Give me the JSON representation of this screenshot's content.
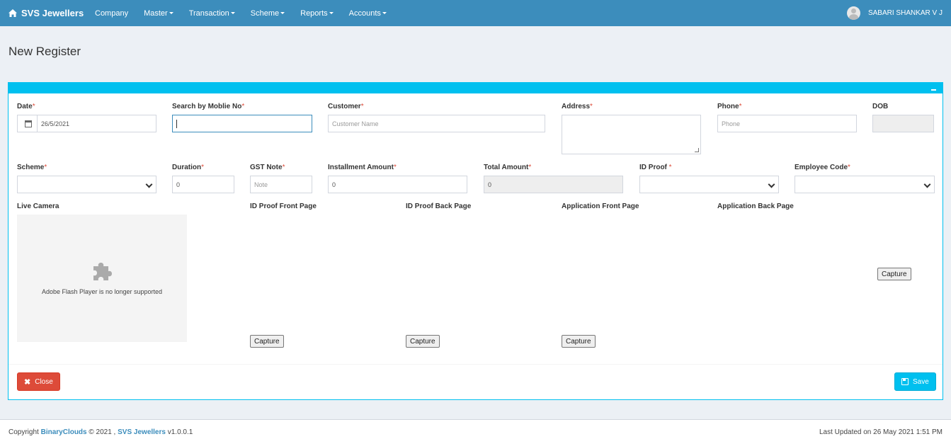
{
  "navbar": {
    "brand": "SVS Jewellers",
    "menu": [
      "Company",
      "Master",
      "Transaction",
      "Scheme",
      "Reports",
      "Accounts"
    ],
    "user": "SABARI SHANKAR V J"
  },
  "page": {
    "title": "New Register"
  },
  "form": {
    "date": {
      "label": "Date",
      "value": "26/5/2021"
    },
    "mobile": {
      "label": "Search by Moblie No",
      "value": ""
    },
    "customer": {
      "label": "Customer",
      "placeholder": "Customer Name"
    },
    "address": {
      "label": "Address",
      "value": ""
    },
    "phone": {
      "label": "Phone",
      "placeholder": "Phone"
    },
    "dob": {
      "label": "DOB",
      "value": ""
    },
    "scheme": {
      "label": "Scheme",
      "value": ""
    },
    "duration": {
      "label": "Duration",
      "value": "0"
    },
    "gst_note": {
      "label": "GST Note",
      "placeholder": "Note"
    },
    "installment": {
      "label": "Installment Amount",
      "value": "0"
    },
    "total": {
      "label": "Total Amount",
      "value": "0"
    },
    "id_proof": {
      "label": "ID Proof ",
      "value": ""
    },
    "employee_code": {
      "label": "Employee Code",
      "value": ""
    },
    "required_mark": "*"
  },
  "camera": {
    "label": "Live Camera",
    "message": "Adobe Flash Player is no longer supported"
  },
  "uploads": {
    "id_front": "ID Proof Front Page",
    "id_back": "ID Proof Back Page",
    "app_front": "Application Front Page",
    "app_back": "Application Back Page",
    "capture_label": "Capture"
  },
  "actions": {
    "close": "Close",
    "save": "Save"
  },
  "footer": {
    "copyright": "Copyright",
    "company": "BinaryClouds",
    "year": "© 2021 ,",
    "product": "SVS Jewellers",
    "version": "v1.0.0.1",
    "updated": "Last Updated on 26 May 2021 1:51 PM"
  }
}
